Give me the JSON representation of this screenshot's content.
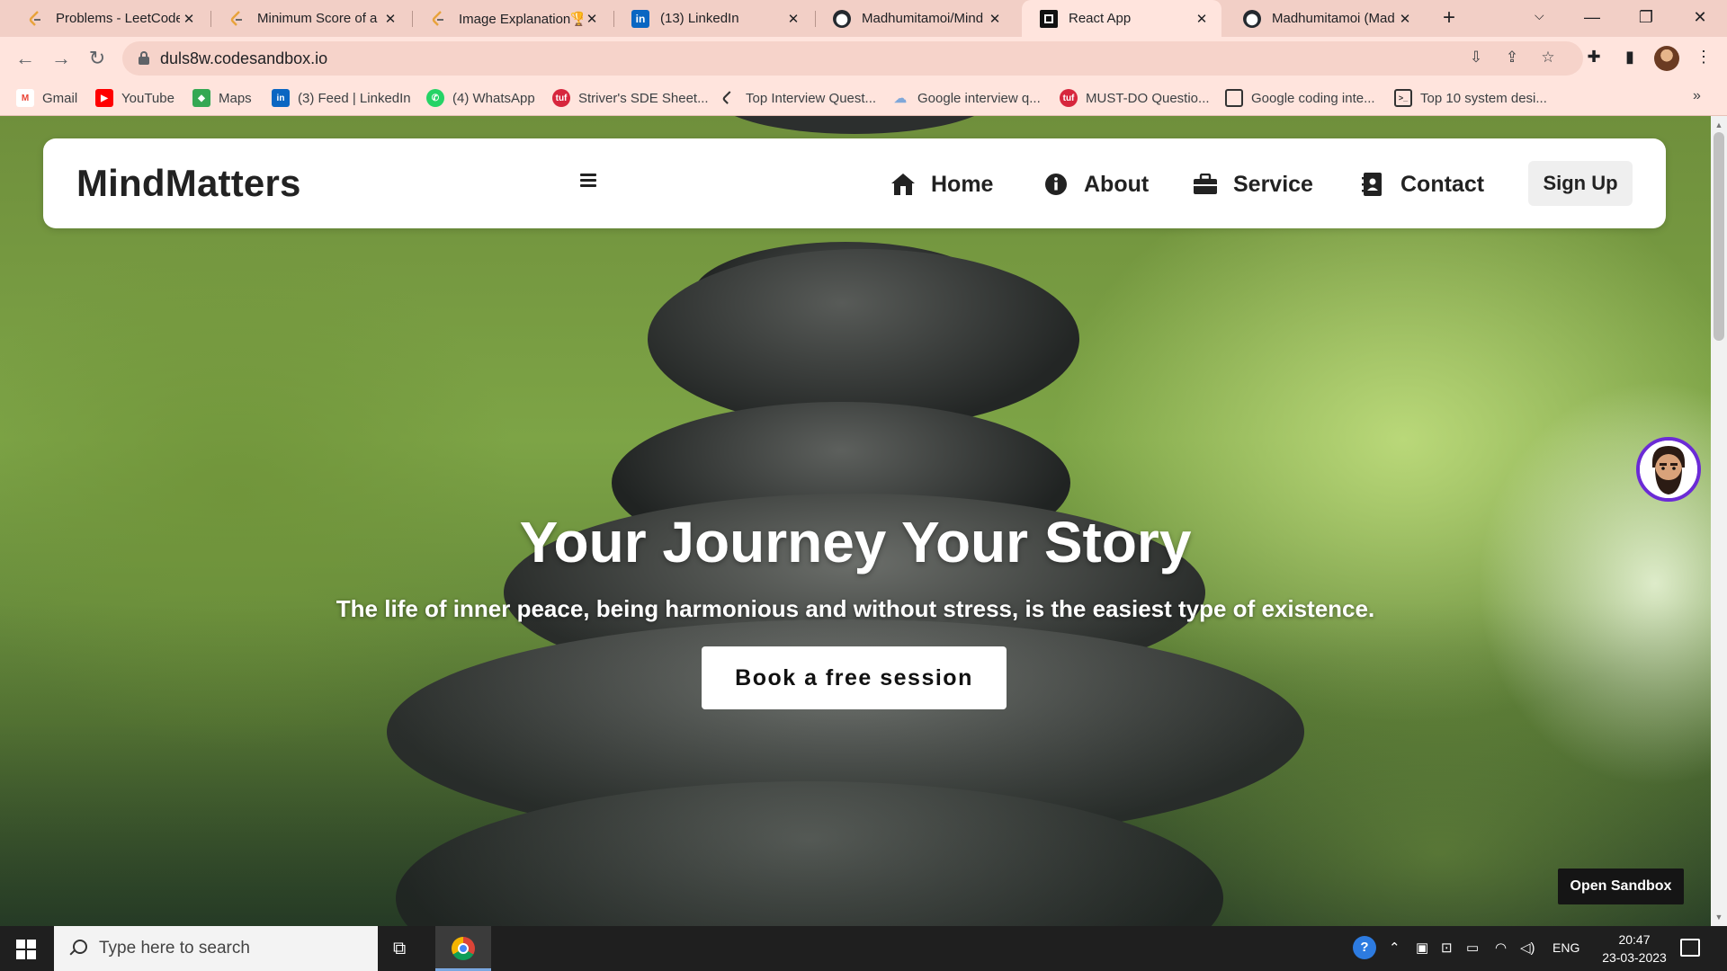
{
  "browser": {
    "tabs": [
      {
        "title": "Problems - LeetCode",
        "icon": "leetcode-icon",
        "active": false
      },
      {
        "title": "Minimum Score of a P",
        "icon": "leetcode-icon",
        "active": false
      },
      {
        "title": "Image Explanation🏆",
        "icon": "leetcode-icon",
        "active": false
      },
      {
        "title": "(13) LinkedIn",
        "icon": "linkedin-icon",
        "active": false
      },
      {
        "title": "Madhumitamoi/Mind",
        "icon": "github-icon",
        "active": false
      },
      {
        "title": "React App",
        "icon": "codesandbox-icon",
        "active": true
      },
      {
        "title": "Madhumitamoi (Mad",
        "icon": "github-icon",
        "active": false
      }
    ],
    "url": "duls8w.codesandbox.io",
    "bookmarks": [
      {
        "label": "Gmail",
        "icon": "gmail-icon",
        "color": "#ea4335"
      },
      {
        "label": "YouTube",
        "icon": "youtube-icon",
        "color": "#ff0000"
      },
      {
        "label": "Maps",
        "icon": "maps-icon",
        "color": "#34a853"
      },
      {
        "label": "(3) Feed | LinkedIn",
        "icon": "linkedin-icon",
        "color": "#0a66c2"
      },
      {
        "label": "(4) WhatsApp",
        "icon": "whatsapp-icon",
        "color": "#25d366"
      },
      {
        "label": "Striver's SDE Sheet...",
        "icon": "tuf-icon",
        "color": "#d7263d"
      },
      {
        "label": "Top Interview Quest...",
        "icon": "leetcode-icon",
        "color": "#333333"
      },
      {
        "label": "Google interview q...",
        "icon": "cloud-icon",
        "color": "#7fa7d9"
      },
      {
        "label": "MUST-DO Questio...",
        "icon": "tuf-icon",
        "color": "#d7263d"
      },
      {
        "label": "Google coding inte...",
        "icon": "page-icon",
        "color": "#333333"
      },
      {
        "label": "Top 10 system desi...",
        "icon": "terminal-icon",
        "color": "#333333"
      }
    ]
  },
  "page": {
    "brand": "MindMatters",
    "nav": [
      {
        "label": "Home",
        "icon": "home-icon"
      },
      {
        "label": "About",
        "icon": "info-icon"
      },
      {
        "label": "Service",
        "icon": "briefcase-icon"
      },
      {
        "label": "Contact",
        "icon": "contact-card-icon"
      }
    ],
    "signup_label": "Sign Up",
    "hero_title": "Your Journey Your Story",
    "hero_subtitle": "The life of inner peace, being harmonious and without stress, is the easiest type of existence.",
    "cta_label": "Book a free session",
    "open_sandbox_label": "Open Sandbox",
    "accent_color": "#6b2bd6"
  },
  "taskbar": {
    "search_placeholder": "Type here to search",
    "language": "ENG",
    "time": "20:47",
    "date": "23-03-2023"
  }
}
